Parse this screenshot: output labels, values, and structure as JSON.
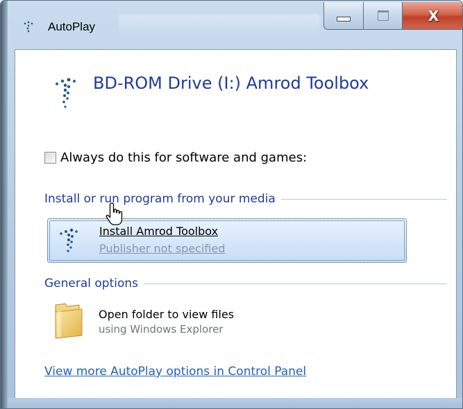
{
  "window": {
    "title": "AutoPlay",
    "icon": "autoplay-icon",
    "controls": {
      "minimize": "minimize-icon",
      "maximize": "maximize-icon",
      "close_glyph": "X"
    }
  },
  "header": {
    "drive_title": "BD-ROM Drive (I:) Amrod Toolbox",
    "icon": "disc-dots-icon"
  },
  "always_do": {
    "label": "Always do this for software and games:",
    "checked": false
  },
  "sections": {
    "install": {
      "label": "Install or run program from your media",
      "option": {
        "title": "Install Amrod Toolbox",
        "subtitle": "Publisher not specified",
        "selected": true,
        "icon": "program-dots-icon"
      }
    },
    "general": {
      "label": "General options",
      "option": {
        "title": "Open folder to view files",
        "subtitle": "using Windows Explorer",
        "icon": "folder-icon"
      }
    }
  },
  "footer": {
    "link": "View more AutoPlay options in Control Panel"
  },
  "colors": {
    "heading_blue": "#1e3a9e",
    "link_blue": "#1f5fc2",
    "selection_fill": "#d6e8f9",
    "close_red": "#c1412a"
  }
}
